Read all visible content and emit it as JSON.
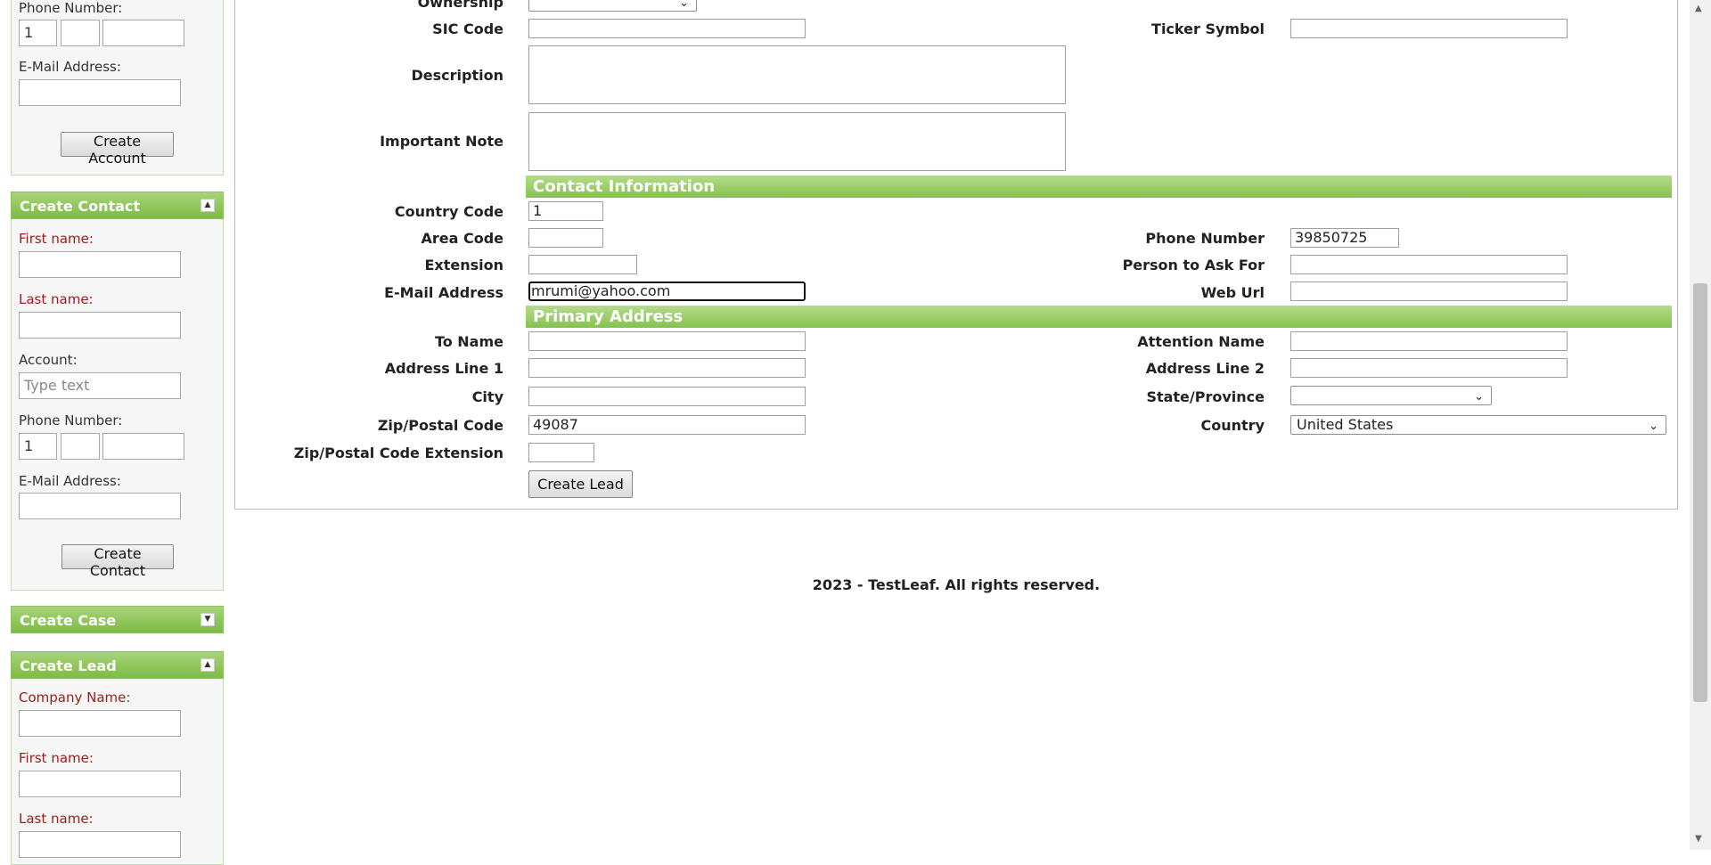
{
  "sidebar": {
    "account_panel": {
      "phone_label": "Phone Number:",
      "phone_country": "1",
      "email_label": "E-Mail Address:",
      "create_button": "Create Account"
    },
    "contact_panel": {
      "title": "Create Contact",
      "first_name_label": "First name:",
      "last_name_label": "Last name:",
      "account_label": "Account:",
      "account_placeholder": "Type text",
      "phone_label": "Phone Number:",
      "phone_country": "1",
      "email_label": "E-Mail Address:",
      "create_button": "Create Contact"
    },
    "case_panel": {
      "title": "Create Case"
    },
    "lead_panel": {
      "title": "Create Lead",
      "company_label": "Company Name:",
      "first_name_label": "First name:",
      "last_name_label": "Last name:"
    }
  },
  "form": {
    "ownership_label": "Ownership",
    "sic_code_label": "SIC Code",
    "ticker_label": "Ticker Symbol",
    "description_label": "Description",
    "important_note_label": "Important Note",
    "contact_section": "Contact Information",
    "country_code_label": "Country Code",
    "country_code_value": "1",
    "area_code_label": "Area Code",
    "phone_label": "Phone Number",
    "phone_value": "39850725",
    "extension_label": "Extension",
    "person_ask_label": "Person to Ask For",
    "email_label": "E-Mail Address",
    "email_value": "mrumi@yahoo.com",
    "web_url_label": "Web Url",
    "address_section": "Primary Address",
    "to_name_label": "To Name",
    "attention_label": "Attention Name",
    "address1_label": "Address Line 1",
    "address2_label": "Address Line 2",
    "city_label": "City",
    "state_label": "State/Province",
    "zip_label": "Zip/Postal Code",
    "zip_value": "49087",
    "country_label": "Country",
    "country_value": "United States",
    "zip_ext_label": "Zip/Postal Code Extension",
    "create_button": "Create Lead"
  },
  "footer": {
    "text": "2023 - TestLeaf. All rights reserved."
  }
}
